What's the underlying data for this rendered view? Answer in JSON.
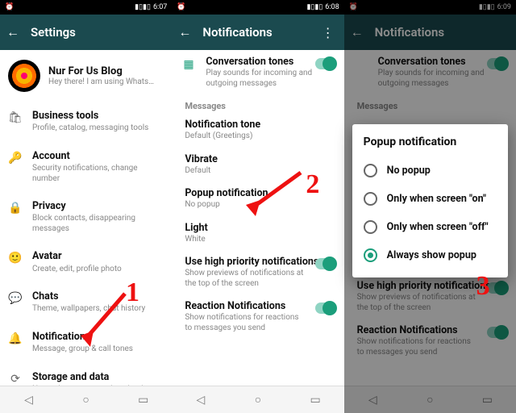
{
  "status": {
    "time1": "6:07",
    "time2": "6:08",
    "time3": "6:09",
    "alarm": "⏰"
  },
  "s1": {
    "header": "Settings",
    "profile": {
      "name": "Nur For Us Blog",
      "sub": "Hey there! I am using Whats…"
    },
    "rows": [
      {
        "icon": "🛍",
        "t": "Business tools",
        "s": "Profile, catalog, messaging tools"
      },
      {
        "icon": "🔑",
        "t": "Account",
        "s": "Security notifications, change number"
      },
      {
        "icon": "🔒",
        "t": "Privacy",
        "s": "Block contacts, disappearing messages"
      },
      {
        "icon": "🙂",
        "t": "Avatar",
        "s": "Create, edit, profile photo"
      },
      {
        "icon": "💬",
        "t": "Chats",
        "s": "Theme, wallpapers, chat history"
      },
      {
        "icon": "🔔",
        "t": "Notifications",
        "s": "Message, group & call tones"
      },
      {
        "icon": "⟳",
        "t": "Storage and data",
        "s": "Network usage, auto-download"
      }
    ]
  },
  "s2": {
    "header": "Notifications",
    "conv": {
      "t": "Conversation tones",
      "s": "Play sounds for incoming and outgoing messages"
    },
    "section": "Messages",
    "tone": {
      "t": "Notification tone",
      "s": "Default (Greetings)"
    },
    "vibrate": {
      "t": "Vibrate",
      "s": "Default"
    },
    "popup": {
      "t": "Popup notification",
      "s": "No popup"
    },
    "light": {
      "t": "Light",
      "s": "White"
    },
    "hipri": {
      "t": "Use high priority notifications",
      "s": "Show previews of notifications at the top of the screen"
    },
    "react": {
      "t": "Reaction Notifications",
      "s": "Show notifications for reactions to messages you send"
    }
  },
  "dialog": {
    "title": "Popup notification",
    "opts": [
      "No popup",
      "Only when screen \"on\"",
      "Only when screen \"off\"",
      "Always show popup"
    ],
    "selected": 3
  },
  "annot": {
    "n1": "1",
    "n2": "2",
    "n3": "3"
  }
}
